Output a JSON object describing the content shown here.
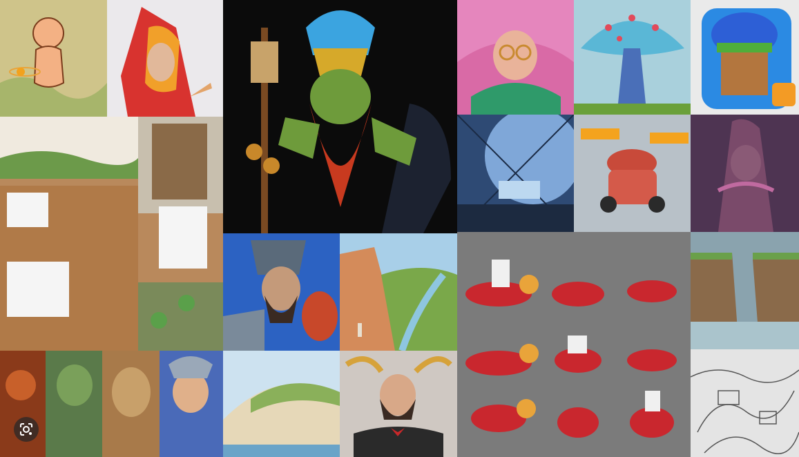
{
  "gallery": {
    "tiles": [
      {
        "name": "tile-character-sketch-bald-kid",
        "bg": "#d8cf9a"
      },
      {
        "name": "tile-red-hooded-wizard",
        "bg": "#e9e7ea"
      },
      {
        "name": "tile-goblin-shaman-hero",
        "bg": "#0a0a0a"
      },
      {
        "name": "tile-pink-haired-elf-girl",
        "bg": "#e06aa0"
      },
      {
        "name": "tile-giant-mushroom",
        "bg": "#9fcdd8"
      },
      {
        "name": "tile-blue-hat-dwarf-app-icon",
        "bg": "#2b8ae3"
      },
      {
        "name": "tile-isometric-restaurant",
        "bg": "#b88a5c"
      },
      {
        "name": "tile-space-station-interior",
        "bg": "#3a5b86"
      },
      {
        "name": "tile-racing-kart",
        "bg": "#b9c3cc"
      },
      {
        "name": "tile-tree-monster",
        "bg": "#5a3a5e"
      },
      {
        "name": "tile-armored-knight-bust",
        "bg": "#2f5fb8"
      },
      {
        "name": "tile-canyon-landscape",
        "bg": "#d69c6a"
      },
      {
        "name": "tile-boat-sprite-sheet",
        "bg": "#7c7c7c"
      },
      {
        "name": "tile-cliff-waterfall",
        "bg": "#7c8a8a"
      },
      {
        "name": "tile-fantasy-character-lineup",
        "bg": "#8a4a2a"
      },
      {
        "name": "tile-coastal-cliffs",
        "bg": "#cfe1ee"
      },
      {
        "name": "tile-bearded-nobleman",
        "bg": "#c9c4c0"
      },
      {
        "name": "tile-pencil-city-sketch",
        "bg": "#dcdcdc"
      }
    ]
  },
  "lens": {
    "icon": "lens-icon"
  }
}
